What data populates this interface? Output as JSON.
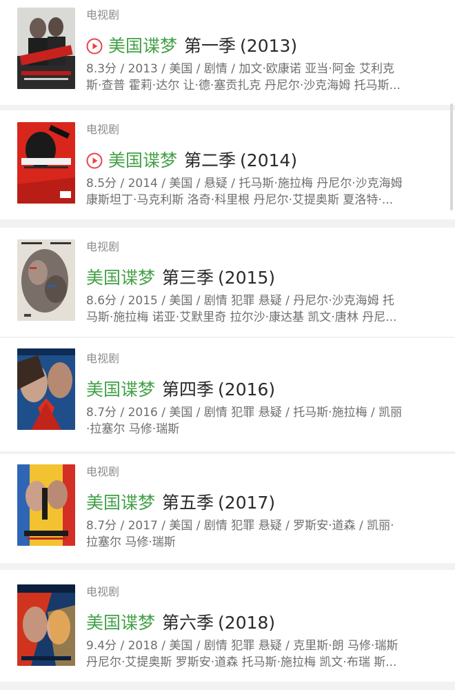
{
  "results": [
    {
      "category": "电视剧",
      "has_play": true,
      "title_name": "美国谍梦",
      "season": "第一季",
      "year": "(2013)",
      "meta_line1": "8.3分 / 2013 / 美国 / 剧情 / 加文·欧康诺 亚当·阿金 艾利克",
      "meta_line2": "斯·查普 霍莉·达尔 让·德·塞贡扎克 丹尼尔·沙克海姆 托马斯..."
    },
    {
      "category": "电视剧",
      "has_play": true,
      "title_name": "美国谍梦",
      "season": "第二季",
      "year": "(2014)",
      "meta_line1": "8.5分 / 2014 / 美国 / 悬疑 / 托马斯·施拉梅 丹尼尔·沙克海姆",
      "meta_line2": "康斯坦丁·马克利斯 洛奇·科里根 丹尼尔·艾提奥斯 夏洛特·..."
    },
    {
      "category": "电视剧",
      "has_play": false,
      "title_name": "美国谍梦",
      "season": "第三季",
      "year": "(2015)",
      "meta_line1": "8.6分 / 2015 / 美国 / 剧情 犯罪 悬疑 / 丹尼尔·沙克海姆 托",
      "meta_line2": "马斯·施拉梅 诺亚·艾默里奇 拉尔沙·康达基 凯文·唐林 丹尼..."
    },
    {
      "category": "电视剧",
      "has_play": false,
      "title_name": "美国谍梦",
      "season": "第四季",
      "year": "(2016)",
      "meta_line1": "8.7分 / 2016 / 美国 / 剧情 犯罪 悬疑 / 托马斯·施拉梅 / 凯丽",
      "meta_line2": "·拉塞尔 马修·瑞斯"
    },
    {
      "category": "电视剧",
      "has_play": false,
      "title_name": "美国谍梦",
      "season": "第五季",
      "year": "(2017)",
      "meta_line1": "8.7分 / 2017 / 美国 / 剧情 犯罪 悬疑 / 罗斯安·道森 / 凯丽·",
      "meta_line2": "拉塞尔 马修·瑞斯"
    },
    {
      "category": "电视剧",
      "has_play": false,
      "title_name": "美国谍梦",
      "season": "第六季",
      "year": "(2018)",
      "meta_line1": "9.4分 / 2018 / 美国 / 剧情 犯罪 悬疑 / 克里斯·朗 马修·瑞斯",
      "meta_line2": "丹尼尔·艾提奥斯 罗斯安·道森 托马斯·施拉梅 凯文·布瑞 斯..."
    }
  ],
  "colors": {
    "title_green": "#42a047",
    "play_icon_red": "#e8424b",
    "meta_gray": "#6e6e6e",
    "category_gray": "#8c8c8c",
    "background": "#f2f2f2"
  },
  "icons": {
    "play": "play-circle-icon"
  }
}
